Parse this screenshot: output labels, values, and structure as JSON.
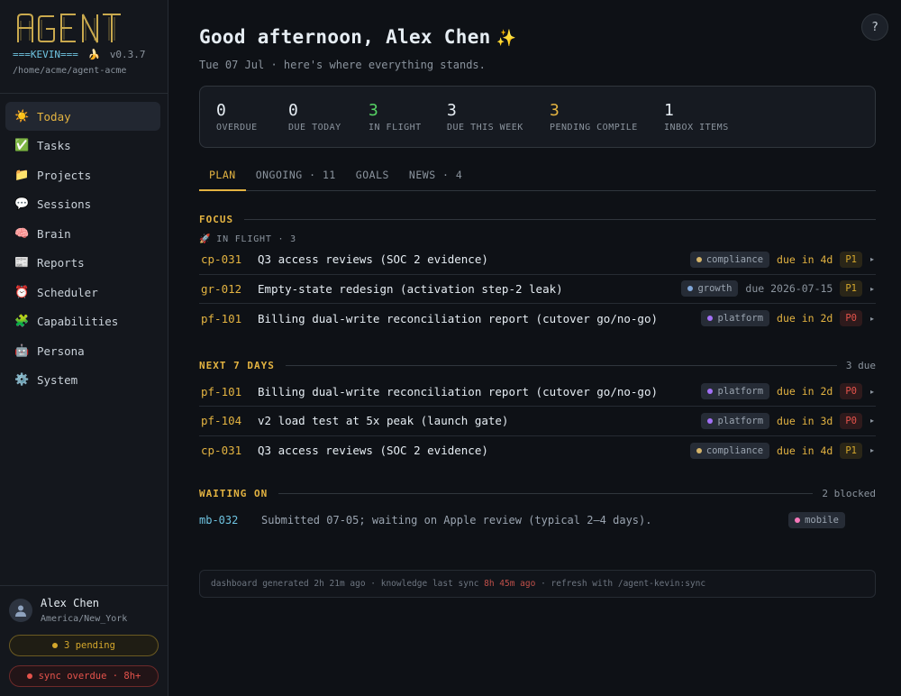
{
  "brand": {
    "logo_text": "AGENT",
    "kevin": "===KEVIN===",
    "emoji": "🍌",
    "version": "v0.3.7",
    "path": "/home/acme/agent-acme"
  },
  "nav": [
    {
      "label": "Today",
      "icon": "☀️",
      "icon_name": "sun-icon",
      "active": true
    },
    {
      "label": "Tasks",
      "icon": "✅",
      "icon_name": "check-icon"
    },
    {
      "label": "Projects",
      "icon": "📁",
      "icon_name": "folder-icon"
    },
    {
      "label": "Sessions",
      "icon": "💬",
      "icon_name": "speech-bubble-icon"
    },
    {
      "label": "Brain",
      "icon": "🧠",
      "icon_name": "brain-icon"
    },
    {
      "label": "Reports",
      "icon": "📰",
      "icon_name": "newspaper-icon"
    },
    {
      "label": "Scheduler",
      "icon": "⏰",
      "icon_name": "alarm-clock-icon"
    },
    {
      "label": "Capabilities",
      "icon": "🧩",
      "icon_name": "puzzle-icon"
    },
    {
      "label": "Persona",
      "icon": "🤖",
      "icon_name": "robot-icon"
    },
    {
      "label": "System",
      "icon": "⚙️",
      "icon_name": "gear-icon"
    }
  ],
  "user": {
    "name": "Alex Chen",
    "timezone": "America/New_York",
    "pending": "3 pending",
    "sync": "sync overdue · 8h+"
  },
  "help_label": "?",
  "header": {
    "greeting": "Good afternoon, Alex Chen",
    "sparkle": "✨",
    "subline": "Tue 07 Jul · here's where everything stands."
  },
  "stats": [
    {
      "value": "0",
      "label": "OVERDUE",
      "color": "#e6edf3"
    },
    {
      "value": "0",
      "label": "DUE TODAY",
      "color": "#e6edf3"
    },
    {
      "value": "3",
      "label": "IN FLIGHT",
      "color": "#56d364"
    },
    {
      "value": "3",
      "label": "DUE THIS WEEK",
      "color": "#e6edf3"
    },
    {
      "value": "3",
      "label": "PENDING COMPILE",
      "color": "#e3b341"
    },
    {
      "value": "1",
      "label": "INBOX ITEMS",
      "color": "#e6edf3"
    }
  ],
  "tabs": [
    {
      "label": "PLAN",
      "active": true
    },
    {
      "label": "ONGOING · 11"
    },
    {
      "label": "GOALS"
    },
    {
      "label": "NEWS · 4"
    }
  ],
  "focus": {
    "title": "FOCUS",
    "subhead_icon": "🚀",
    "subhead": "IN FLIGHT · 3",
    "rows": [
      {
        "id": "cp-031",
        "title": "Q3 access reviews (SOC 2 evidence)",
        "tag": "compliance",
        "tag_color": "#d4b46a",
        "due": "due in 4d",
        "due_style": "warn",
        "prio": "P1"
      },
      {
        "id": "gr-012",
        "title": "Empty-state redesign (activation step-2 leak)",
        "tag": "growth",
        "tag_color": "#7fa6d9",
        "due": "due 2026-07-15",
        "due_style": "plain",
        "prio": "P1"
      },
      {
        "id": "pf-101",
        "title": "Billing dual-write reconciliation report (cutover go/no-go)",
        "tag": "platform",
        "tag_color": "#a371f7",
        "due": "due in 2d",
        "due_style": "warn",
        "prio": "P0"
      }
    ]
  },
  "next7": {
    "title": "NEXT 7 DAYS",
    "count": "3 due",
    "rows": [
      {
        "id": "pf-101",
        "title": "Billing dual-write reconciliation report (cutover go/no-go)",
        "tag": "platform",
        "tag_color": "#a371f7",
        "due": "due in 2d",
        "due_style": "warn",
        "prio": "P0"
      },
      {
        "id": "pf-104",
        "title": "v2 load test at 5x peak (launch gate)",
        "tag": "platform",
        "tag_color": "#a371f7",
        "due": "due in 3d",
        "due_style": "warn",
        "prio": "P0"
      },
      {
        "id": "cp-031",
        "title": "Q3 access reviews (SOC 2 evidence)",
        "tag": "compliance",
        "tag_color": "#d4b46a",
        "due": "due in 4d",
        "due_style": "warn",
        "prio": "P1"
      }
    ]
  },
  "waiting": {
    "title": "WAITING ON",
    "count": "2 blocked",
    "rows": [
      {
        "id": "mb-032",
        "text": "Submitted 07-05; waiting on Apple review (typical 2–4 days).",
        "tag": "mobile",
        "tag_color": "#f778ba"
      }
    ]
  },
  "footer": {
    "part1": "dashboard generated 2h 21m ago · knowledge last sync ",
    "sync_age": "8h 45m ago",
    "part2": " · refresh with /agent-kevin:sync"
  }
}
